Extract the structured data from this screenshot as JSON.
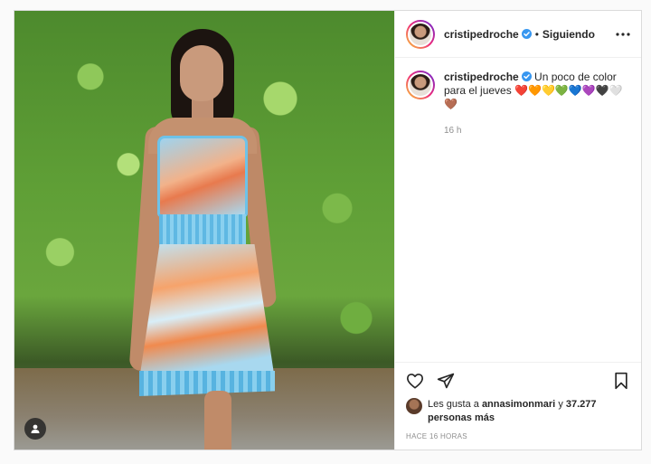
{
  "header": {
    "username": "cristipedroche",
    "separator": "•",
    "follow_status": "Siguiendo"
  },
  "caption": {
    "username": "cristipedroche",
    "text": "Un poco de color para el jueves",
    "emojis": "❤️🧡💛💚💙💜🖤🤍🤎",
    "time": "16 h"
  },
  "likes": {
    "prefix": "Les gusta a",
    "user": "annasimonmari",
    "conjunction": "y",
    "count": "37.277 personas más"
  },
  "posted_ago": "HACE 16 HORAS",
  "colors": {
    "verified": "#3897f0",
    "border": "#dbdbdb",
    "muted": "#8e8e8e",
    "text": "#262626"
  },
  "icons": {
    "header_more": "more-horizontal-icon",
    "like": "heart-icon",
    "share": "paper-plane-icon",
    "save": "bookmark-icon",
    "tagged_users": "user-tag-icon",
    "verified": "verified-badge-icon"
  }
}
